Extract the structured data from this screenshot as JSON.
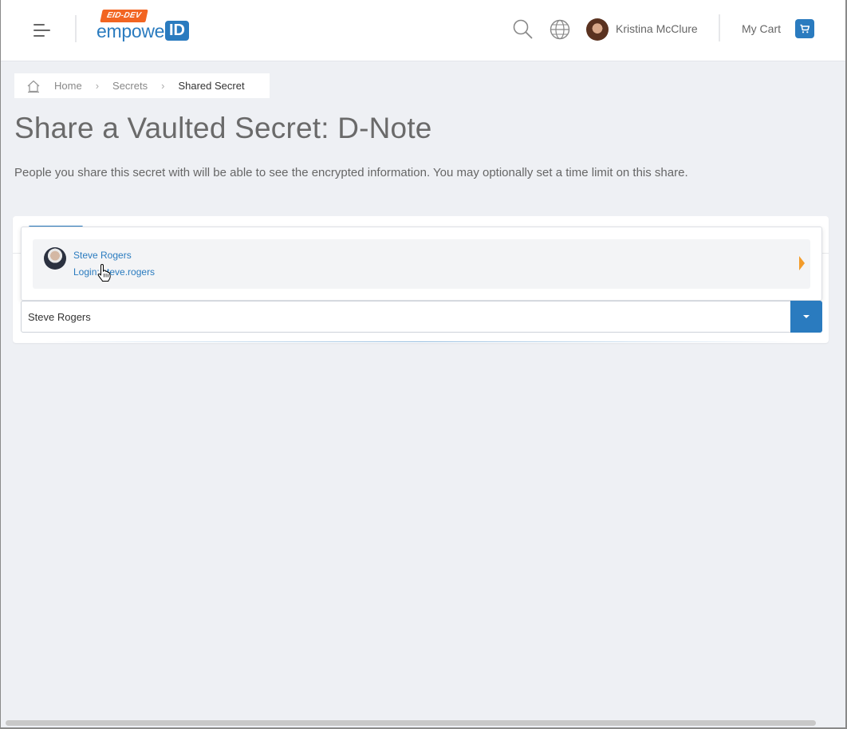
{
  "header": {
    "logo_tag": "EID-DEV",
    "logo_word": "empower",
    "logo_id": "ID",
    "user_name": "Kristina McClure",
    "cart_label": "My Cart",
    "icons": [
      "menu-icon",
      "search-icon",
      "globe-icon",
      "cart-icon"
    ]
  },
  "breadcrumb": {
    "items": [
      "Home",
      "Secrets",
      "Shared Secret"
    ]
  },
  "page": {
    "title": "Share a Vaulted Secret: D-Note",
    "description": "People you share this secret with will be able to see the encrypted information. You may optionally set a time limit on this share."
  },
  "picker": {
    "input_value": "Steve Rogers",
    "suggestions": [
      {
        "name": "Steve Rogers",
        "login": "Login: steve.rogers"
      }
    ]
  },
  "colors": {
    "accent": "#2a7bbf",
    "brand_tag": "#f26522",
    "arrow": "#f39c2b",
    "background": "#eef0f4"
  }
}
